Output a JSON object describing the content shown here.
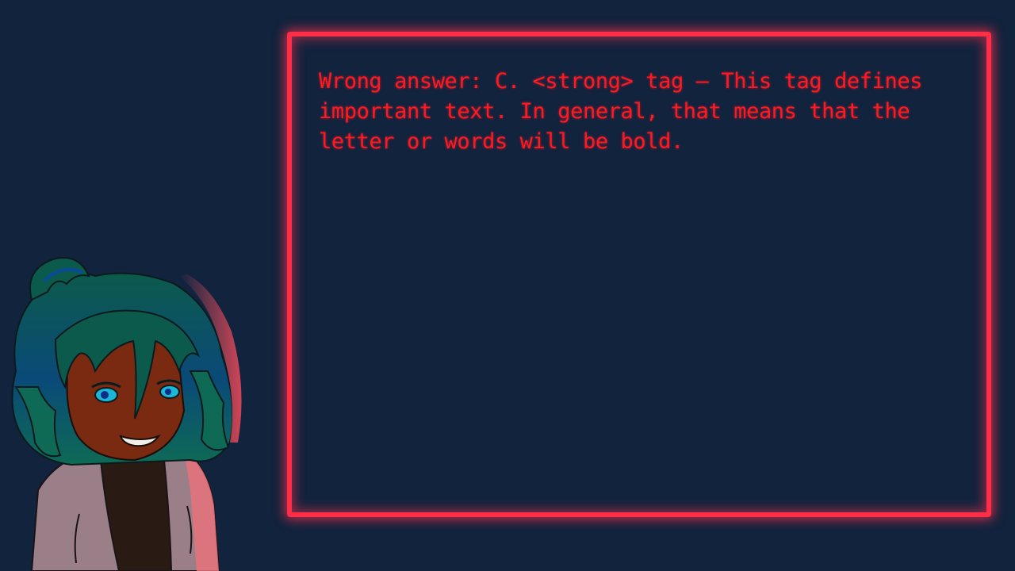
{
  "dialog": {
    "text": "Wrong answer: C. <strong> tag – This tag defines important text. In general, that means that the letter or words will be bold."
  },
  "character": {
    "icon": "character-portrait"
  },
  "colors": {
    "background": "#12233d",
    "frame": "#ff2e48",
    "text": "#ff1a22"
  }
}
